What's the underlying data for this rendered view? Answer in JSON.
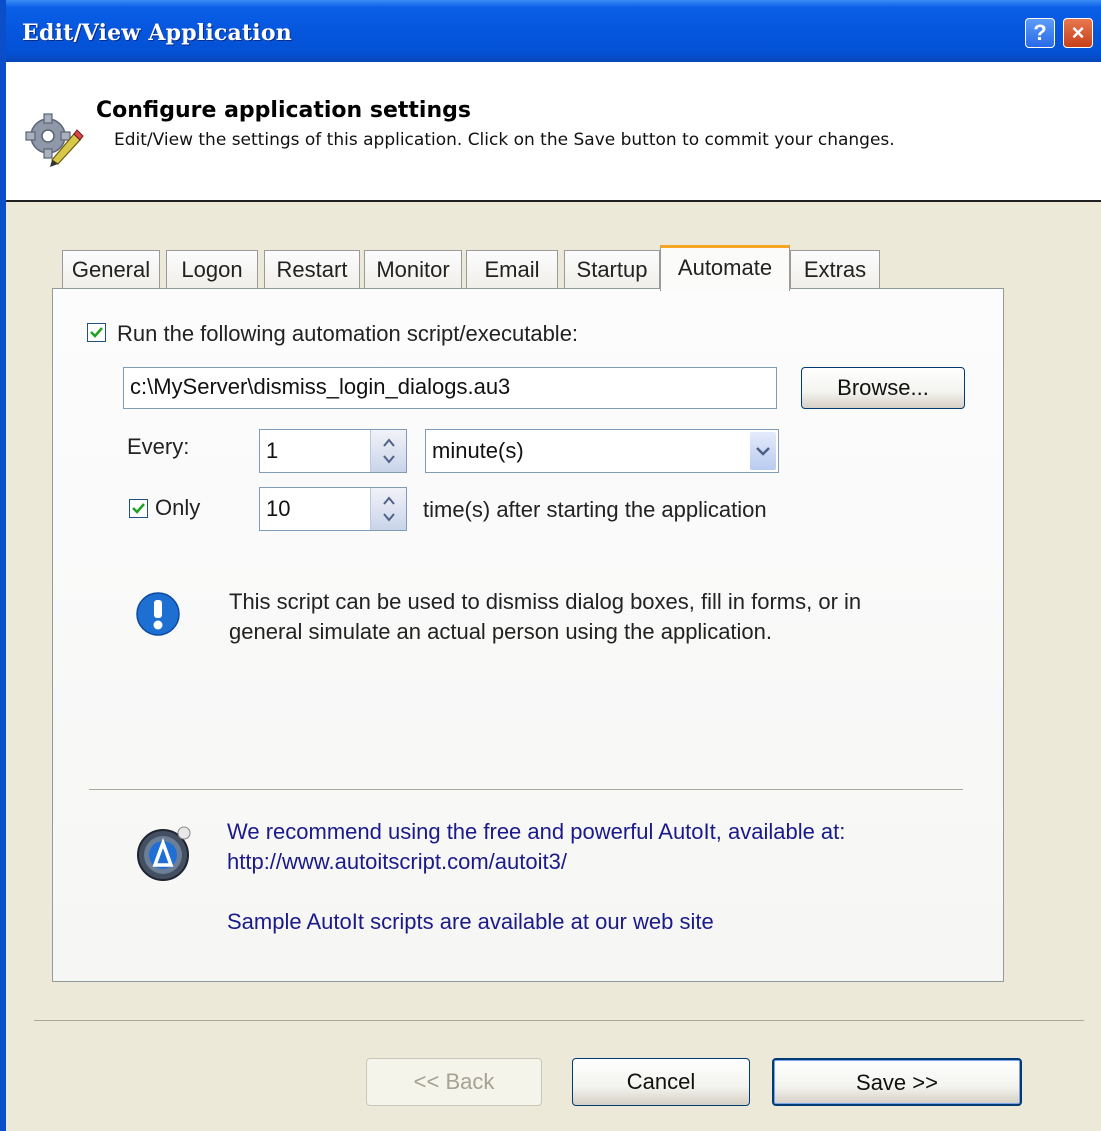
{
  "window": {
    "title": "Edit/View Application",
    "help_label": "?",
    "close_label": "×"
  },
  "header": {
    "title": "Configure application settings",
    "subtitle": "Edit/View the settings of this application. Click on the Save button to commit your changes.",
    "icon": "gear-pencil-icon"
  },
  "tabs": [
    {
      "label": "General"
    },
    {
      "label": "Logon"
    },
    {
      "label": "Restart"
    },
    {
      "label": "Monitor"
    },
    {
      "label": "Email"
    },
    {
      "label": "Startup"
    },
    {
      "label": "Automate"
    },
    {
      "label": "Extras"
    }
  ],
  "active_tab": "Automate",
  "automate": {
    "run_checkbox_label": "Run the following automation script/executable:",
    "run_checked": true,
    "script_path": "c:\\MyServer\\dismiss_login_dialogs.au3",
    "browse_label": "Browse...",
    "every_label": "Every:",
    "every_value": "1",
    "unit_value": "minute(s)",
    "only_label": "Only",
    "only_checked": true,
    "only_value": "10",
    "times_suffix": "time(s) after starting the application",
    "info_line1": "This script can be used to dismiss dialog boxes, fill in forms, or in",
    "info_line2": "general simulate an actual person using the application.",
    "recommend_line1": "We recommend using the free and powerful AutoIt, available at:",
    "recommend_link": "http://www.autoitscript.com/autoit3/",
    "sample_link": "Sample AutoIt scripts are available at our web site"
  },
  "footer": {
    "back_label": "<< Back",
    "cancel_label": "Cancel",
    "save_label": "Save >>"
  },
  "colors": {
    "titlebar": "#0556dd",
    "accent_tab": "#f5a623",
    "link": "#1a1a8a",
    "info": "#1d6fd1"
  }
}
